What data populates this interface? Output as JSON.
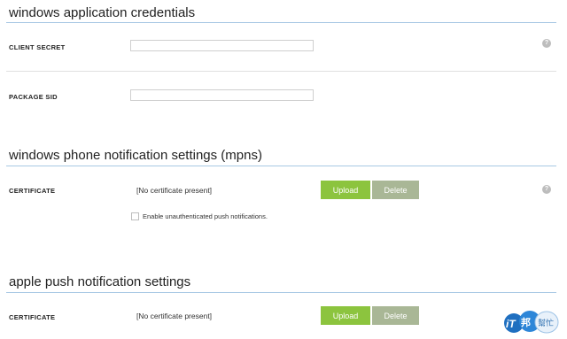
{
  "sections": {
    "windows_app": {
      "title": "windows application credentials",
      "client_secret_label": "CLIENT SECRET",
      "client_secret_value": "",
      "package_sid_label": "PACKAGE SID",
      "package_sid_value": ""
    },
    "mpns": {
      "title": "windows phone notification settings (mpns)",
      "certificate_label": "CERTIFICATE",
      "certificate_status": "[No certificate present]",
      "upload_label": "Upload",
      "delete_label": "Delete",
      "checkbox_label": "Enable unauthenticated push notifications.",
      "checkbox_checked": false
    },
    "apns": {
      "title": "apple push notification settings",
      "certificate_label": "CERTIFICATE",
      "certificate_status": "[No certificate present]",
      "upload_label": "Upload",
      "delete_label": "Delete"
    }
  },
  "help_icon_glyph": "?",
  "watermark": {
    "text": "iT邦幫忙"
  },
  "colors": {
    "accent_rule": "#a8c8e4",
    "upload_button": "#8cc43e",
    "delete_button": "#a9b796",
    "help_icon": "#bdbdbd"
  }
}
